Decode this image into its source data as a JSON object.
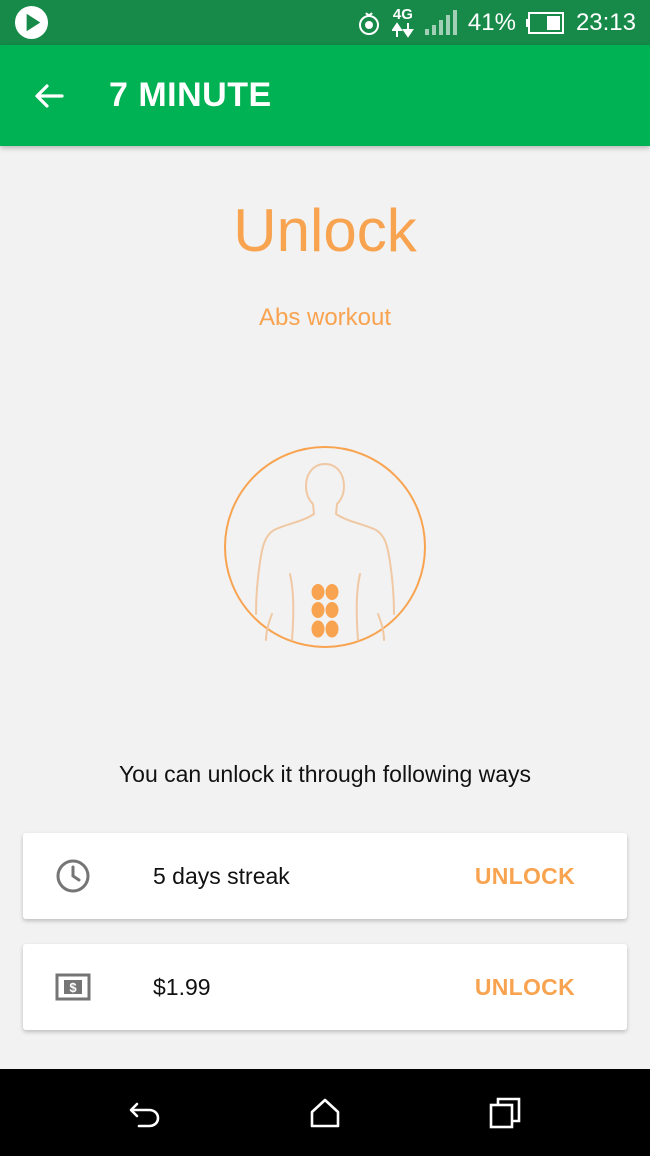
{
  "status_bar": {
    "battery_percent": "41%",
    "time": "23:13",
    "network": "4G",
    "icons": [
      "play-store-icon",
      "notification-icon",
      "network-4g-icon",
      "signal-icon",
      "battery-icon"
    ]
  },
  "app_bar": {
    "title": "7 MINUTE",
    "back_icon": "arrow-back-icon"
  },
  "content": {
    "headline": "Unlock",
    "subtitle": "Abs workout",
    "illustration": "abs-body-icon",
    "instructions": "You can unlock it through following ways"
  },
  "options": [
    {
      "icon": "clock-icon",
      "label": "5 days streak",
      "action": "UNLOCK"
    },
    {
      "icon": "dollar-bill-icon",
      "label": "$1.99",
      "action": "UNLOCK"
    }
  ],
  "nav_bar": {
    "icons": [
      "back-nav-icon",
      "home-nav-icon",
      "recents-nav-icon"
    ]
  },
  "colors": {
    "status_bar": "#178a49",
    "app_bar": "#00b253",
    "accent": "#f8a350",
    "background": "#f2f2f2"
  }
}
